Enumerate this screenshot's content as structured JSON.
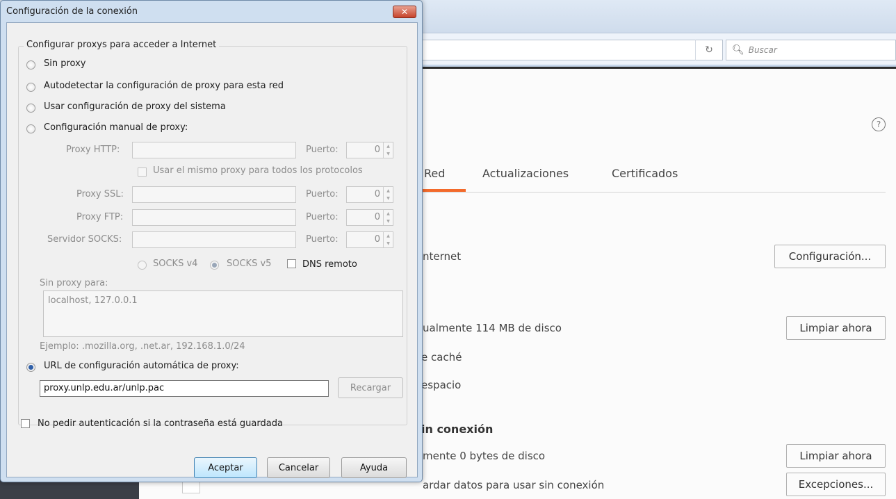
{
  "browser": {
    "search_placeholder": "Buscar",
    "reload_icon": "reload-icon",
    "help_icon": "?",
    "tabs": [
      {
        "label": "Red"
      },
      {
        "label": "Actualizaciones"
      },
      {
        "label": "Certificados"
      }
    ],
    "network": {
      "connection_text": "nternet",
      "configure_button": "Configuración...",
      "cache_usage": "ualmente 114 MB de disco",
      "clear_now_button": "Limpiar ahora",
      "cache_text": "e caché",
      "space_text": "espacio",
      "offline_heading": "in conexión",
      "offline_usage": "mente 0 bytes de disco",
      "offline_clear_button": "Limpiar ahora",
      "offline_text": "ardar datos para usar sin conexión",
      "exceptions_button": "Excepciones..."
    }
  },
  "dialog": {
    "title": "Configuración de la conexión",
    "close_label": "✕",
    "group_legend": "Configurar proxys para acceder a Internet",
    "options": {
      "no_proxy": "Sin proxy",
      "auto_detect": "Autodetectar la configuración de proxy para esta red",
      "system": "Usar configuración de proxy del sistema",
      "manual": "Configuración manual de proxy:"
    },
    "manual": {
      "http_label": "Proxy HTTP:",
      "port_label": "Puerto:",
      "http_port": "0",
      "same_proxy": "Usar el mismo proxy para todos los protocolos",
      "ssl_label": "Proxy SSL:",
      "ssl_port": "0",
      "ftp_label": "Proxy FTP:",
      "ftp_port": "0",
      "socks_label": "Servidor SOCKS:",
      "socks_port": "0",
      "socks_v4": "SOCKS v4",
      "socks_v5": "SOCKS v5",
      "dns_remote": "DNS remoto"
    },
    "no_proxy_for_label": "Sin proxy para:",
    "no_proxy_for_value": "localhost, 127.0.0.1",
    "example": "Ejemplo: .mozilla.org, .net.ar, 192.168.1.0/24",
    "auto_url_label": "URL de configuración automática de proxy:",
    "auto_url_value": "proxy.unlp.edu.ar/unlp.pac",
    "reload_button": "Recargar",
    "no_auth_prompt": "No pedir autenticación si la contraseña está guardada",
    "accept_button": "Aceptar",
    "cancel_button": "Cancelar",
    "help_button": "Ayuda"
  }
}
